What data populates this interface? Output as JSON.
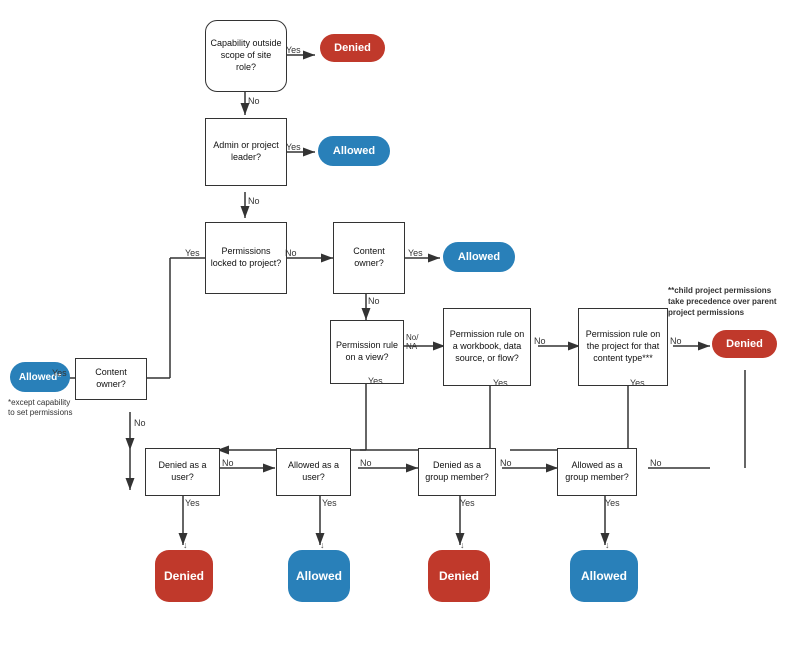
{
  "nodes": {
    "capability": {
      "label": "Capability outside scope of site role?"
    },
    "admin": {
      "label": "Admin or project leader?"
    },
    "permissions_locked": {
      "label": "Permissions locked to project?"
    },
    "content_owner1": {
      "label": "Content owner?"
    },
    "content_owner2": {
      "label": "Content owner?"
    },
    "permission_view": {
      "label": "Permission rule on a view?"
    },
    "permission_workbook": {
      "label": "Permission rule on a workbook, data source, or flow?"
    },
    "permission_project": {
      "label": "Permission rule on the project for that content type***"
    },
    "denied_user": {
      "label": "Denied as a user?"
    },
    "allowed_user": {
      "label": "Allowed as a user?"
    },
    "denied_group": {
      "label": "Denied as a group member?"
    },
    "allowed_group": {
      "label": "Allowed as a group member?"
    }
  },
  "badges": {
    "denied_top": "Denied",
    "allowed_admin": "Allowed",
    "allowed_owner": "Allowed",
    "allowed_left": "Allowed*",
    "denied_bottom1": "Denied",
    "allowed_bottom2": "Allowed",
    "denied_bottom3": "Denied",
    "allowed_bottom4": "Allowed",
    "denied_right": "Denied"
  },
  "labels": {
    "yes": "Yes",
    "no": "No",
    "note_allowed": "*except capability to set permissions",
    "note_child": "**child project permissions take precedence over parent project permissions"
  }
}
